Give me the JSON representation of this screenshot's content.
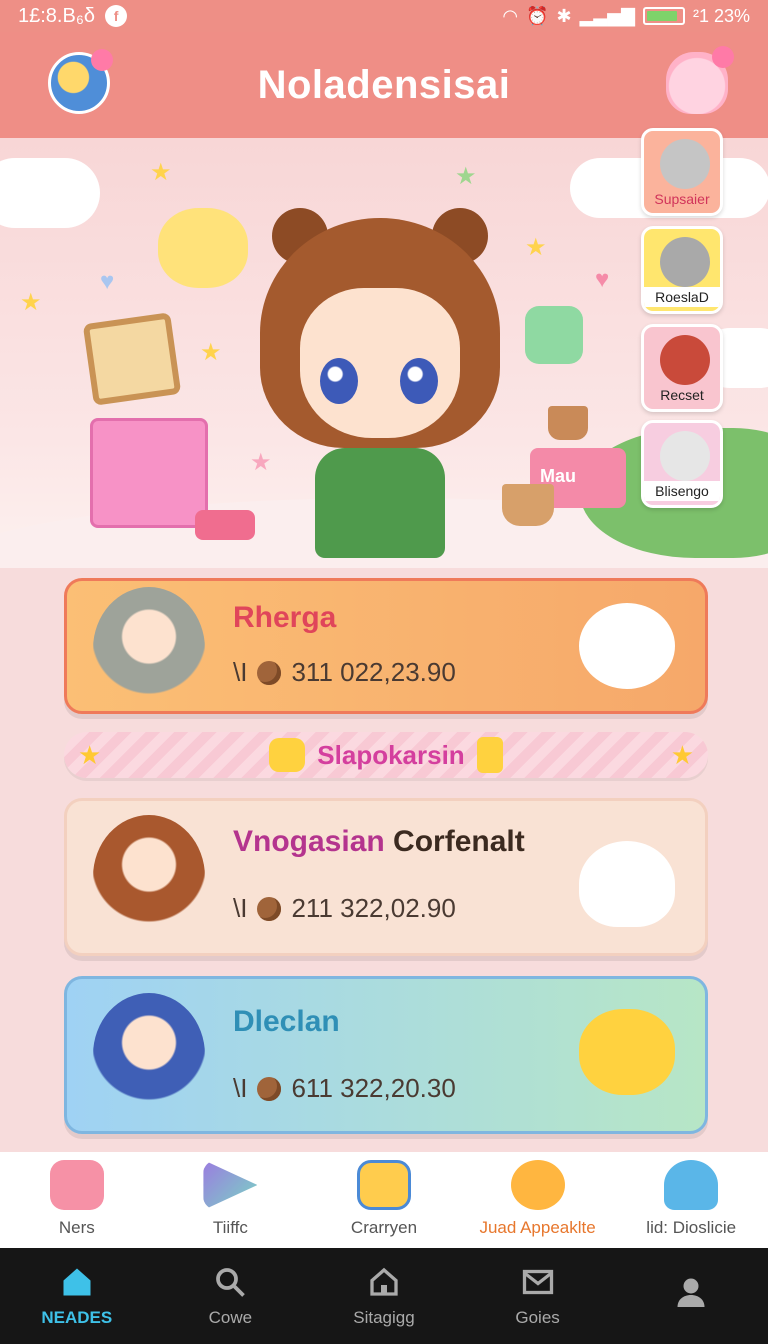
{
  "status_bar": {
    "time": "1£:8.B₆δ",
    "badge": "f",
    "battery_text": "²1 23%"
  },
  "header": {
    "title": "Noladensisai"
  },
  "side_characters": [
    {
      "label": "Supsaier"
    },
    {
      "label": "RoeslaD"
    },
    {
      "label": "Recset"
    },
    {
      "label": "Blisengo"
    }
  ],
  "scene": {
    "book_label": "Mau"
  },
  "cards": [
    {
      "name": "Rherga",
      "score_prefix": "\\I",
      "score": "311 022,23.90"
    },
    {
      "name_a": "Vnogasian",
      "name_b": "Corfenalt",
      "score_prefix": "\\I",
      "score": "211 322,02.90"
    },
    {
      "name": "Dleclan",
      "score_prefix": "\\I",
      "score": "611 322,20.30"
    }
  ],
  "banner": {
    "text": "Slapokarsin"
  },
  "nav_top": [
    {
      "label": "Ners"
    },
    {
      "label": "Tiiffc"
    },
    {
      "label": "Crarryen"
    },
    {
      "label": "Juad Appeaklte"
    },
    {
      "label": "lid: Dioslicie"
    }
  ],
  "nav_bottom": [
    {
      "label": "NEADES"
    },
    {
      "label": "Cowe"
    },
    {
      "label": "Sitagigg"
    },
    {
      "label": "Goies"
    }
  ],
  "colors": {
    "header": "#ef8e86",
    "active_nav": "#3ec1e8",
    "card1": "#f6a86a",
    "card3": "#a7dde0"
  }
}
